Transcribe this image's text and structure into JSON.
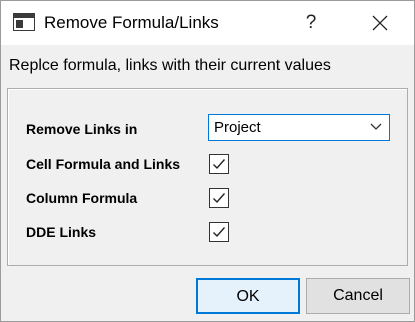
{
  "window": {
    "title": "Remove Formula/Links",
    "help_label": "?",
    "close_icon": "close-icon",
    "app_icon": "window-icon"
  },
  "description": "Replce formula, links with their current values",
  "options": {
    "remove_links_in": {
      "label": "Remove Links in",
      "selected": "Project"
    },
    "cell_formula_and_links": {
      "label": "Cell Formula and Links",
      "checked": true
    },
    "column_formula": {
      "label": "Column Formula",
      "checked": true
    },
    "dde_links": {
      "label": "DDE Links",
      "checked": true
    }
  },
  "buttons": {
    "ok_label": "OK",
    "cancel_label": "Cancel"
  },
  "colors": {
    "accent": "#0078d7",
    "dialog_background": "#f0f0f0",
    "button_default": "#e5f1fb"
  }
}
